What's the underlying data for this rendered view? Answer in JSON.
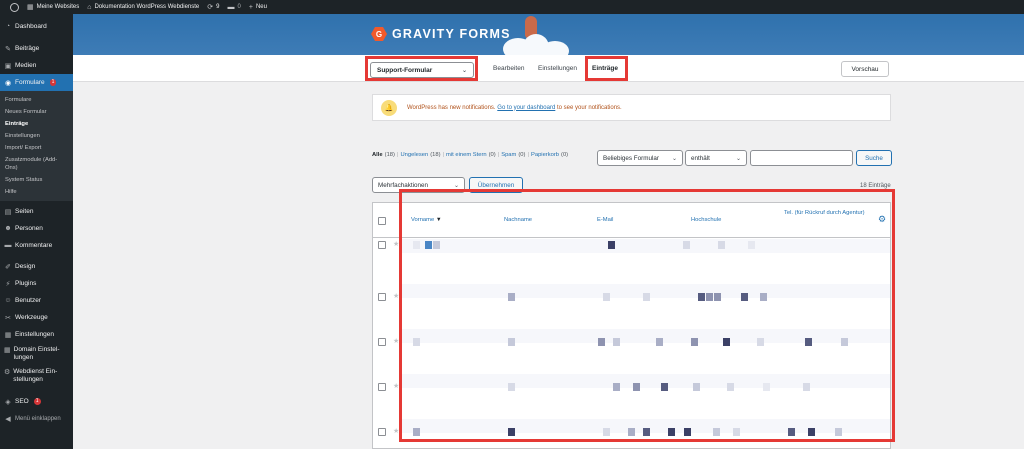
{
  "adminbar": {
    "site_label": "Meine Websites",
    "doc_label": "Dokumentation WordPress Webdienste",
    "updates_count": "9",
    "comments_count": "0",
    "new_label": "Neu"
  },
  "sidebar": {
    "items": [
      {
        "label": "Dashboard",
        "icon": "dashboard-icon"
      },
      {
        "label": "Beiträge",
        "icon": "pin-icon"
      },
      {
        "label": "Medien",
        "icon": "media-icon"
      },
      {
        "label": "Formulare",
        "icon": "forms-icon",
        "badge": "1"
      },
      {
        "label": "Seiten",
        "icon": "pages-icon"
      },
      {
        "label": "Personen",
        "icon": "person-icon"
      },
      {
        "label": "Kommentare",
        "icon": "comment-icon"
      },
      {
        "label": "Design",
        "icon": "brush-icon"
      },
      {
        "label": "Plugins",
        "icon": "plugin-icon"
      },
      {
        "label": "Benutzer",
        "icon": "users-icon"
      },
      {
        "label": "Werkzeuge",
        "icon": "wrench-icon"
      },
      {
        "label": "Einstellungen",
        "icon": "settings-icon"
      },
      {
        "label": "Domain Einstel- lungen",
        "icon": "settings-icon"
      },
      {
        "label": "Webdienst Ein- stellungen",
        "icon": "gear-icon"
      },
      {
        "label": "SEO",
        "icon": "seo-icon",
        "badge": "1"
      },
      {
        "label": "Menü einklappen",
        "icon": "collapse-icon"
      }
    ],
    "submenu": [
      "Formulare",
      "Neues Formular",
      "Einträge",
      "Einstellungen",
      "Import/ Export",
      "Zusatzmodule (Add-Ons)",
      "System Status",
      "Hilfe"
    ]
  },
  "header": {
    "logo_text": "GRAVITY FORMS",
    "logo_mark": "G"
  },
  "toolbar": {
    "form_select": "Support-Formular",
    "edit_label": "Bearbeiten",
    "settings_label": "Einstellungen",
    "entries_label": "Einträge",
    "preview_label": "Vorschau"
  },
  "notice": {
    "text_before": "WordPress has new notifications.",
    "link_text": "Go to your dashboard",
    "text_after": "to see your notifications."
  },
  "filters": {
    "all": "Alle",
    "all_count": "(18)",
    "unread": "Ungelesen",
    "unread_count": "(18)",
    "starred": "mit einem Stern",
    "starred_count": "(0)",
    "spam": "Spam",
    "spam_count": "(0)",
    "trash": "Papierkorb",
    "trash_count": "(0)",
    "field_select": "Beliebiges Formular",
    "operator_select": "enthält",
    "search_button": "Suche"
  },
  "bulk": {
    "select": "Mehrfachaktionen",
    "apply": "Übernehmen",
    "entry_count": "18 Einträge"
  },
  "table": {
    "columns": [
      "Vorname",
      "Nachname",
      "E-Mail",
      "Hochschule",
      "Tel. (für Rückruf durch Agentur)"
    ],
    "sort_indicator": "▼"
  },
  "colors": {
    "accent": "#2271b1",
    "header_blue": "#3e7cb6",
    "highlight_red": "#e53935",
    "admin_dark": "#1d2327"
  }
}
